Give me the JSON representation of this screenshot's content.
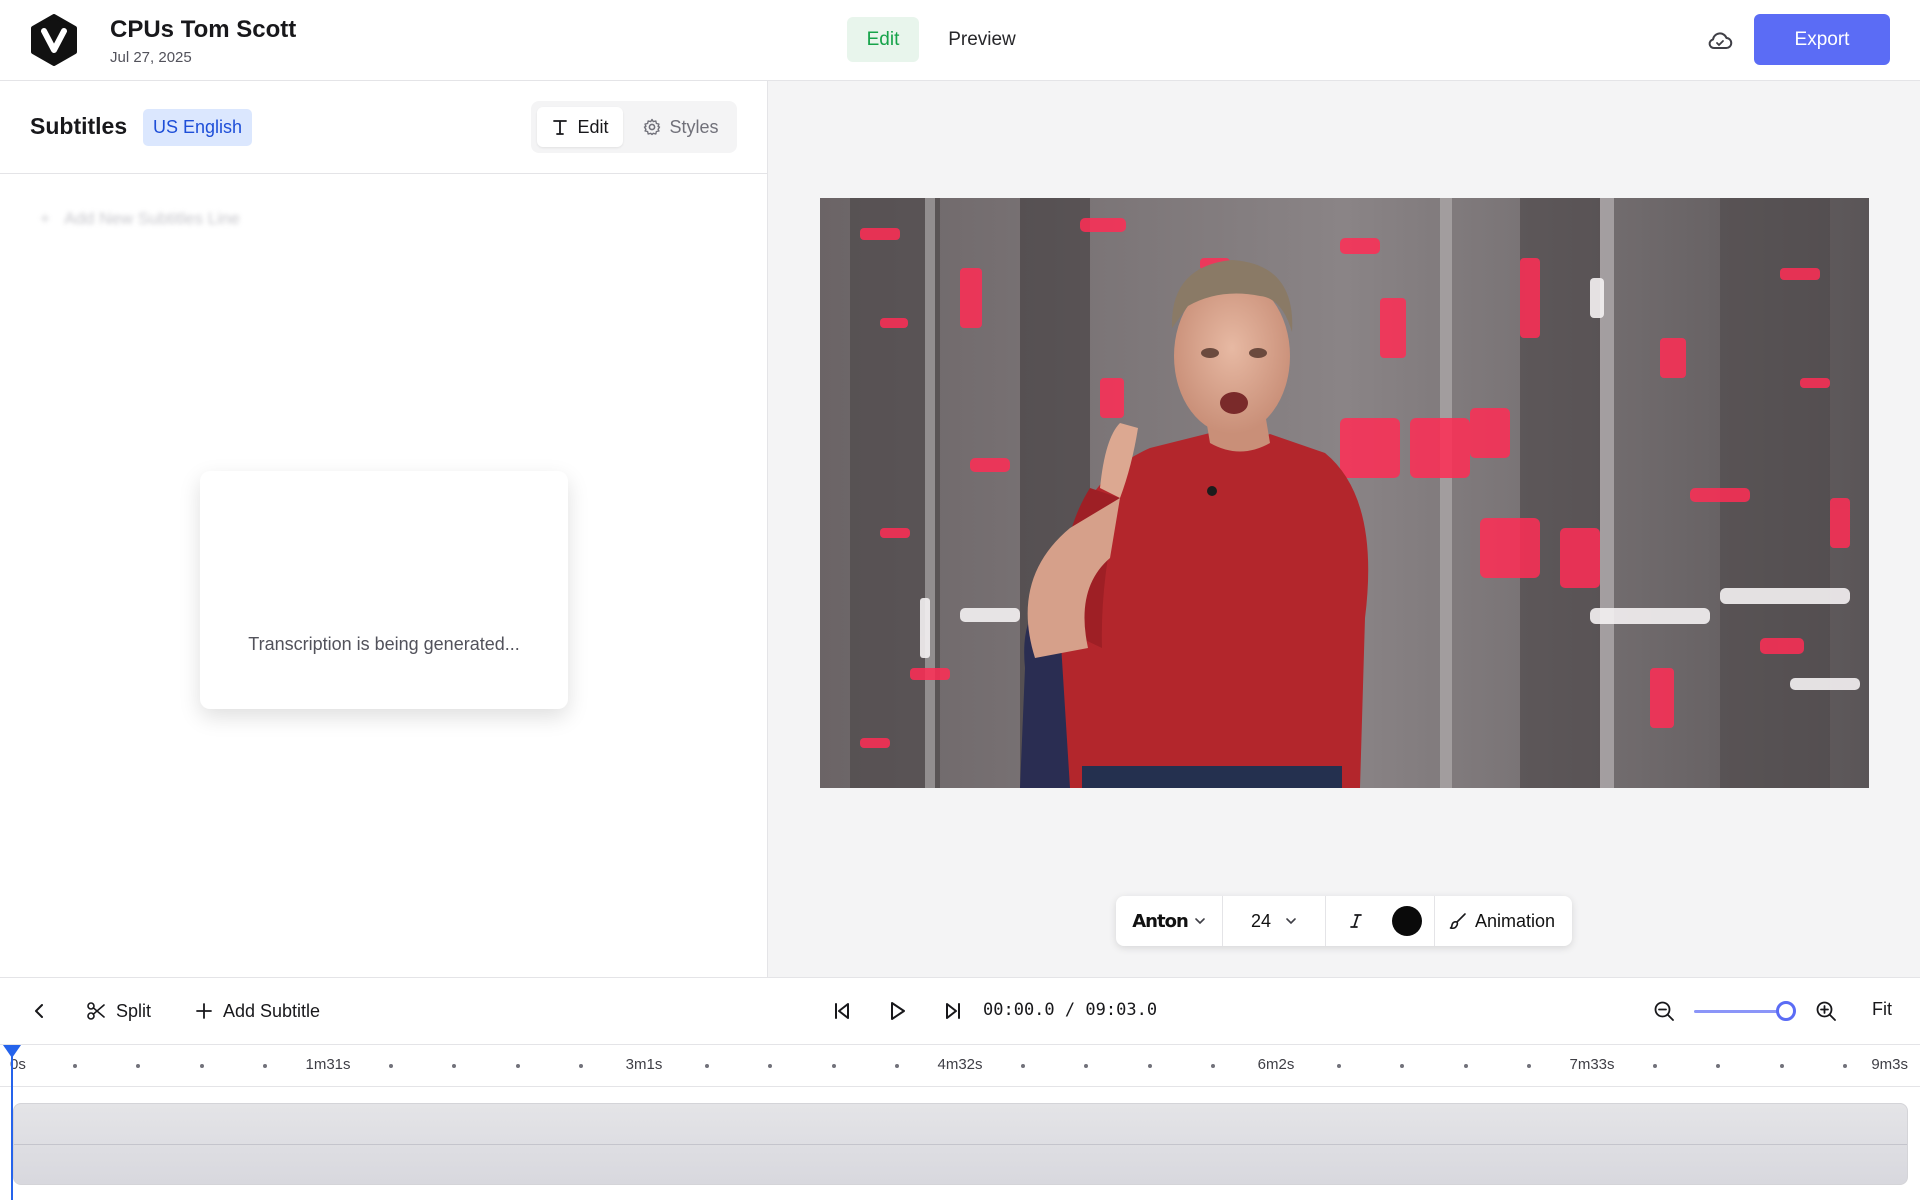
{
  "header": {
    "project_title": "CPUs Tom Scott",
    "project_date": "Jul 27, 2025",
    "mode_edit": "Edit",
    "mode_preview": "Preview",
    "export_label": "Export",
    "accent_color": "#5b6cf5",
    "active_mode_color": "#16a34a"
  },
  "subtitles_panel": {
    "title": "Subtitles",
    "language_badge": "US English",
    "tab_edit": "Edit",
    "tab_styles": "Styles",
    "add_line_label": "Add New Subtitles Line",
    "status_text": "Transcription is being generated..."
  },
  "style_toolbar": {
    "font": "Anton",
    "size": "24",
    "text_color": "#0a0a0a",
    "animation_label": "Animation"
  },
  "timeline_toolbar": {
    "split_label": "Split",
    "add_subtitle_label": "Add Subtitle",
    "current_time": "00:00.0",
    "separator": "/",
    "total_time": "09:03.0",
    "fit_label": "Fit",
    "zoom_level_fraction": 1.0
  },
  "ruler": {
    "ticks": [
      "0s",
      "1m31s",
      "3m1s",
      "4m32s",
      "6m2s",
      "7m33s",
      "9m3s"
    ]
  },
  "icons": [
    "logo-icon",
    "cloud-icon",
    "text-icon",
    "gear-icon",
    "chevron-down-icon",
    "italic-icon",
    "brush-icon",
    "chevron-left-icon",
    "scissors-icon",
    "plus-icon",
    "skip-back-icon",
    "play-icon",
    "skip-forward-icon",
    "zoom-out-icon",
    "zoom-in-icon"
  ]
}
